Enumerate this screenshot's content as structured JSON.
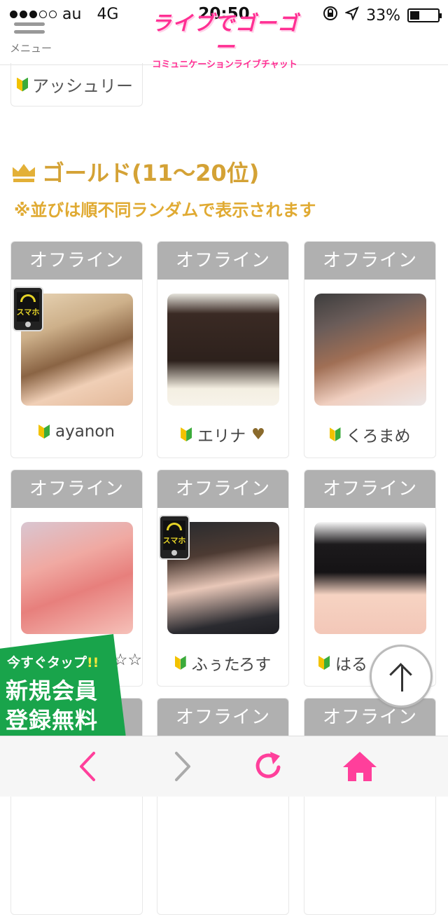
{
  "status_bar": {
    "carrier": "au",
    "network": "4G",
    "time": "20:50",
    "battery": "33%",
    "battery_level": 0.33
  },
  "header": {
    "menu_label": "メニュー",
    "logo_title": "ライブでゴーゴー",
    "logo_subtitle": "コミュニケーションライブチャット"
  },
  "top_card": {
    "name": "アッシュリー"
  },
  "section": {
    "title": "ゴールド(11〜20位)",
    "note": "※並びは順不同ランダムで表示されます"
  },
  "performers": [
    {
      "status": "オフライン",
      "name": "ayanon"
    },
    {
      "status": "オフライン",
      "name": "エリナ"
    },
    {
      "status": "オフライン",
      "name": "くろまめ"
    },
    {
      "status": "オフライン",
      "name": "☆☆"
    },
    {
      "status": "オフライン",
      "name": "ふぅたろす"
    },
    {
      "status": "オフライン",
      "name": "はる"
    },
    {
      "status": ""
    },
    {
      "status": "オフライン"
    },
    {
      "status": "オフライン"
    }
  ],
  "badges": {
    "smartphone": "スマホ"
  },
  "register_banner": {
    "line1": "今すぐタップ",
    "line1_mark": "!!",
    "line2": "新規会員",
    "line3": "登録無料"
  },
  "colors": {
    "brand_pink": "#ff2f93",
    "gold": "#d4a235",
    "offline_gray": "#b0b0b0",
    "register_green": "#19a44b"
  },
  "icons": {
    "toolbar": [
      "back-icon",
      "forward-icon",
      "reload-icon",
      "home-icon"
    ]
  }
}
